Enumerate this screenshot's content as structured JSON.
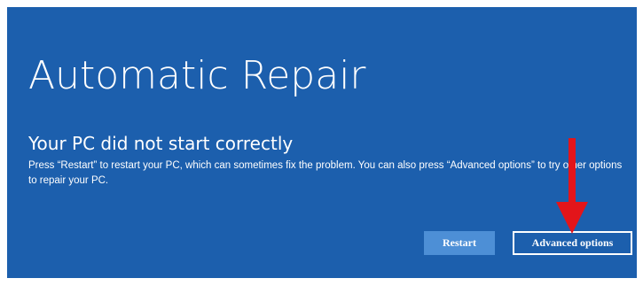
{
  "screen": {
    "title": "Automatic Repair",
    "subtitle": "Your PC did not start correctly",
    "message": "Press “Restart” to restart your PC, which can sometimes fix the problem. You can also press “Advanced options” to try other options to repair your PC."
  },
  "buttons": {
    "restart_label": "Restart",
    "advanced_label": "Advanced options"
  },
  "colors": {
    "background": "#1c5fad",
    "restart_button": "#4d8fd6",
    "annotation_arrow": "#e3151a"
  },
  "annotation": {
    "icon": "red-down-arrow-icon"
  }
}
